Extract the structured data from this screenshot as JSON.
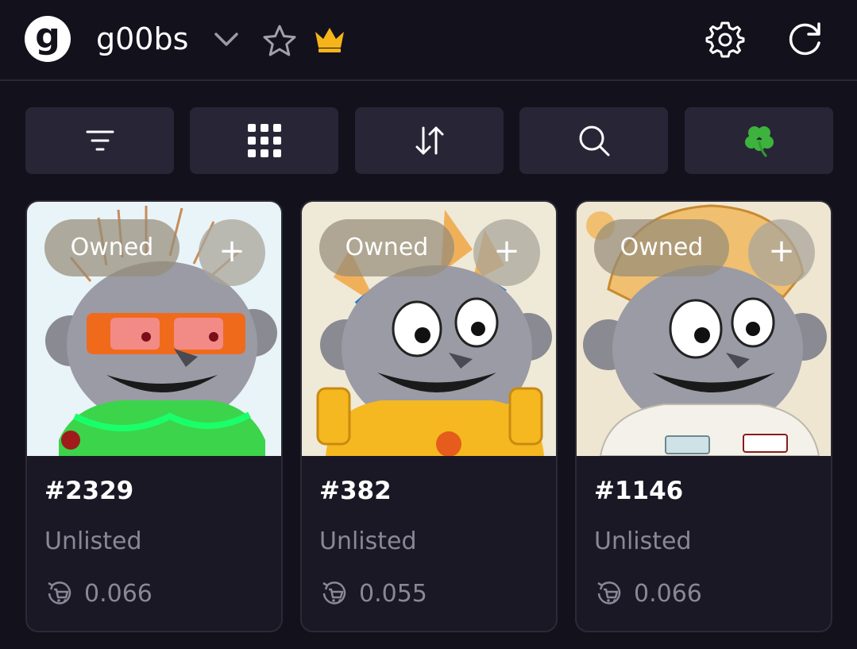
{
  "header": {
    "logo_letter": "g",
    "title": "g00bs",
    "icons": [
      "chevron-down-icon",
      "star-icon",
      "crown-icon",
      "settings-gear-icon",
      "refresh-icon"
    ]
  },
  "toolbar": {
    "buttons": [
      {
        "icon": "filter-icon"
      },
      {
        "icon": "grid-view-icon"
      },
      {
        "icon": "sort-icon"
      },
      {
        "icon": "search-icon"
      },
      {
        "icon": "clover-icon"
      }
    ]
  },
  "cards": [
    {
      "badge": "Owned",
      "add_label": "+",
      "id": "#2329",
      "status": "Unlisted",
      "price": "0.066",
      "price_icon": "cart-refresh-icon"
    },
    {
      "badge": "Owned",
      "add_label": "+",
      "id": "#382",
      "status": "Unlisted",
      "price": "0.055",
      "price_icon": "cart-refresh-icon"
    },
    {
      "badge": "Owned",
      "add_label": "+",
      "id": "#1146",
      "status": "Unlisted",
      "price": "0.066",
      "price_icon": "cart-refresh-icon"
    }
  ],
  "colors": {
    "background": "#13111c",
    "surface": "#282636",
    "card": "#1a1825",
    "muted_text": "#8a8797",
    "crown": "#f4b41a",
    "clover": "#3db33d"
  }
}
